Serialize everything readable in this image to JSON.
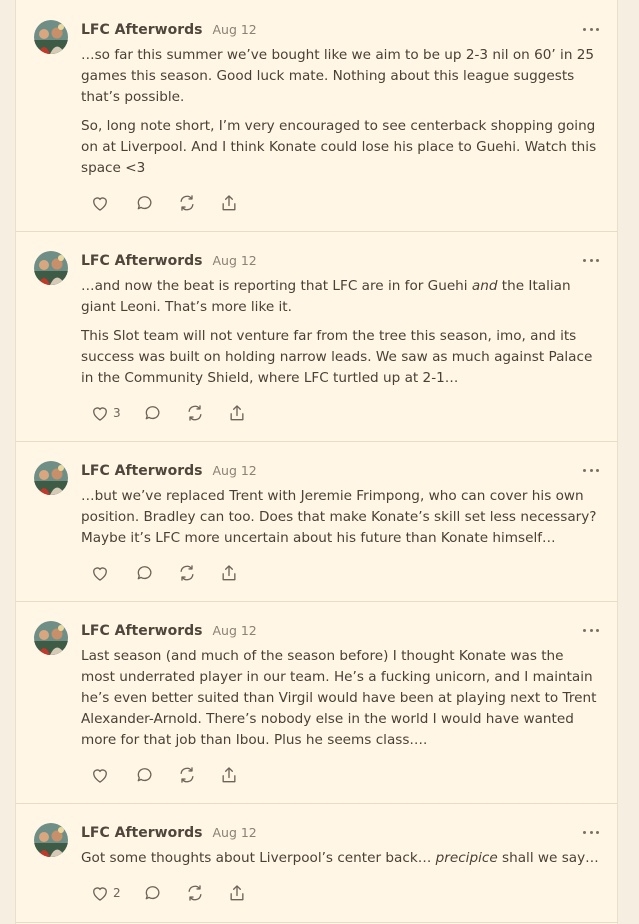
{
  "posts": [
    {
      "author": "LFC Afterwords",
      "date": "Aug 12",
      "p1": "…so far this summer we’ve bought like we aim to be up 2-3 nil on 60’ in 25 games this season. Good luck mate. Nothing about this league suggests that’s possible.",
      "p2": "So, long note short, I’m very encouraged to see centerback shopping going on at Liverpool. And I think Konate could lose his place to Guehi. Watch this space <3",
      "likes": ""
    },
    {
      "author": "LFC Afterwords",
      "date": "Aug 12",
      "p1_a": "…and now the beat is reporting that LFC are in for Guehi ",
      "p1_em": "and",
      "p1_b": " the Italian giant Leoni. That’s more like it.",
      "p2": "This Slot team will not venture far from the tree this season, imo, and its success was built on holding narrow leads. We saw as much against Palace in the Community Shield, where LFC turtled up at 2-1…",
      "likes": "3"
    },
    {
      "author": "LFC Afterwords",
      "date": "Aug 12",
      "p1": "…but we’ve replaced Trent with Jeremie Frimpong, who can cover his own position. Bradley can too. Does that make Konate’s skill set less necessary? Maybe it’s LFC more uncertain about his future than Konate himself…",
      "likes": ""
    },
    {
      "author": "LFC Afterwords",
      "date": "Aug 12",
      "p1": "Last season (and much of the season before) I thought Konate was the most underrated player in our team. He’s a fucking unicorn, and I maintain he’s even better suited than Virgil would have been at playing next to Trent Alexander-Arnold. There’s nobody else in the world I would have wanted more for that job than Ibou. Plus he seems class….",
      "likes": ""
    },
    {
      "author": "LFC Afterwords",
      "date": "Aug 12",
      "p1_a": "Got some thoughts about Liverpool’s center back… ",
      "p1_em": "precipice",
      "p1_b": " shall we say…",
      "likes": "2"
    }
  ]
}
